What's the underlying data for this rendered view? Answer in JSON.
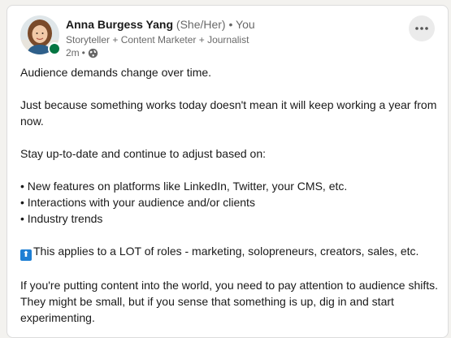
{
  "post": {
    "author": {
      "name": "Anna Burgess Yang",
      "pronouns": "(She/Her)",
      "separator": "•",
      "degree": "You",
      "headline": "Storyteller + Content Marketer + Journalist",
      "time": "2m",
      "meta_separator": "•",
      "visibility_icon": "globe-icon",
      "online_status_color": "#057642"
    },
    "more_icon": "ellipsis-icon",
    "paragraphs": [
      "Audience demands change over time.",
      "Just because something works today doesn't mean it will keep working a year from now.",
      "Stay up-to-date and continue to adjust based on:"
    ],
    "bullets": [
      "• New features on platforms like LinkedIn, Twitter, your CMS, etc.",
      "• Interactions with your audience and/or clients",
      "• Industry trends"
    ],
    "emoji_line": {
      "emoji_icon": "up-arrow-button-emoji",
      "emoji_glyph": "⬆",
      "emoji_color": "#1f7fd4",
      "text": "This applies to a LOT of roles - marketing, solopreneurs, creators, sales, etc."
    },
    "closing": "If you're putting content into the world, you need to pay attention to audience shifts. They might be small, but if you sense that something is up, dig in and start experimenting."
  }
}
